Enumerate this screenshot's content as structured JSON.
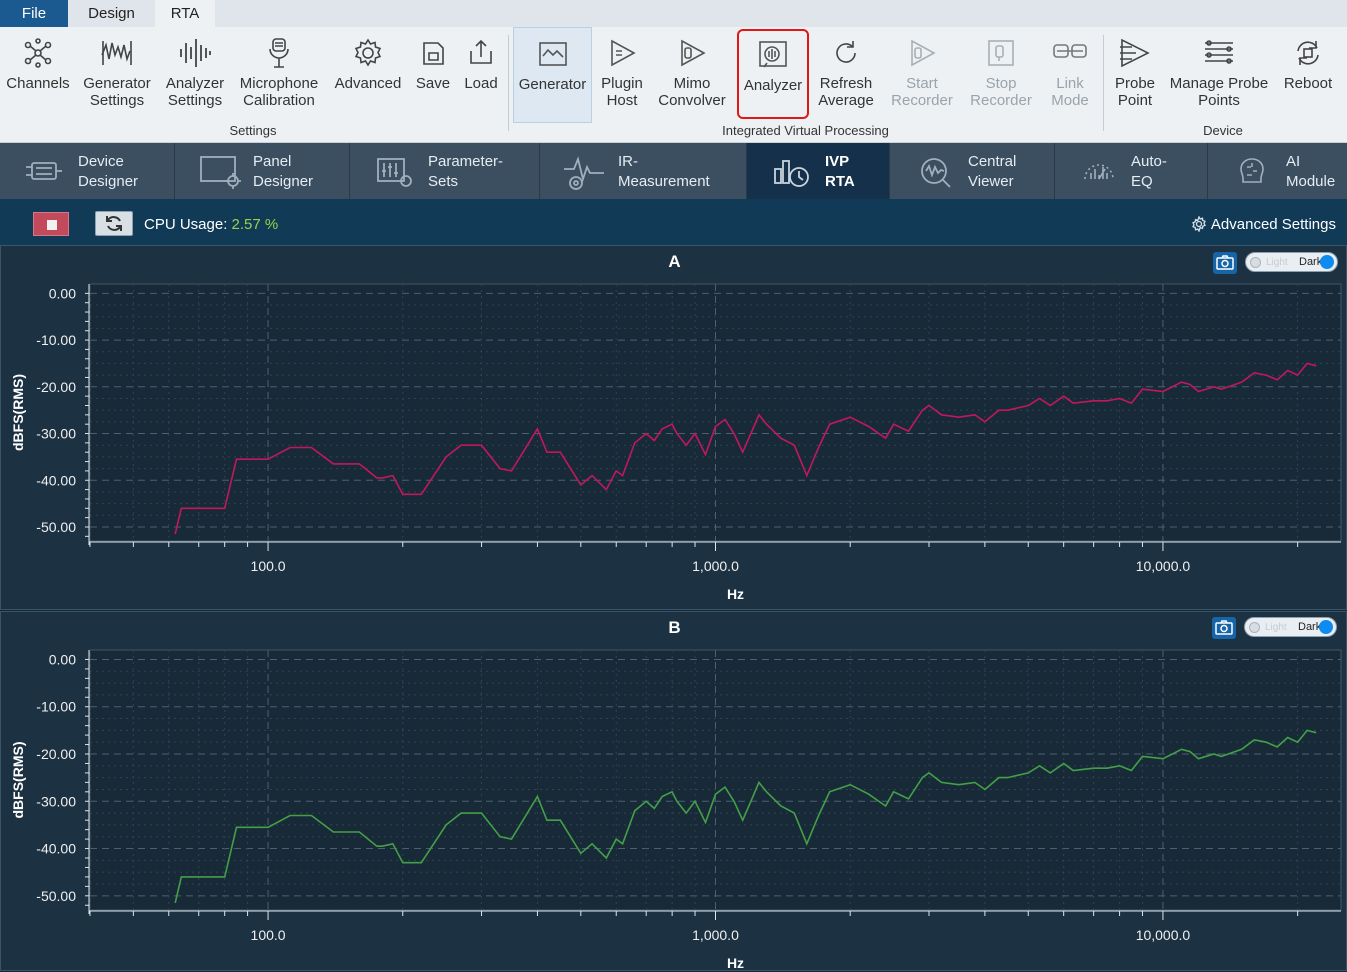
{
  "menu": {
    "tabs": [
      {
        "label": "File"
      },
      {
        "label": "Design"
      },
      {
        "label": "RTA"
      }
    ]
  },
  "ribbon": {
    "buttons": [
      {
        "label": "Channels",
        "icon": "channels-icon"
      },
      {
        "label": "Generator\nSettings",
        "icon": "generator-settings-icon"
      },
      {
        "label": "Analyzer\nSettings",
        "icon": "analyzer-settings-icon"
      },
      {
        "label": "Microphone\nCalibration",
        "icon": "microphone-icon"
      },
      {
        "label": "Advanced",
        "icon": "gear-icon"
      },
      {
        "label": "Save",
        "icon": "save-icon"
      },
      {
        "label": "Load",
        "icon": "load-icon"
      },
      {
        "label": "Generator",
        "icon": "generator-icon"
      },
      {
        "label": "Plugin\nHost",
        "icon": "plugin-host-icon"
      },
      {
        "label": "Mimo\nConvolver",
        "icon": "mimo-convolver-icon"
      },
      {
        "label": "Analyzer",
        "icon": "analyzer-icon"
      },
      {
        "label": "Refresh\nAverage",
        "icon": "refresh-icon"
      },
      {
        "label": "Start\nRecorder",
        "icon": "start-recorder-icon",
        "disabled": true
      },
      {
        "label": "Stop\nRecorder",
        "icon": "stop-recorder-icon",
        "disabled": true
      },
      {
        "label": "Link\nMode",
        "icon": "link-icon",
        "disabled": true
      },
      {
        "label": "Probe\nPoint",
        "icon": "probe-point-icon"
      },
      {
        "label": "Manage Probe\nPoints",
        "icon": "manage-probe-points-icon"
      },
      {
        "label": "Reboot",
        "icon": "reboot-icon"
      }
    ],
    "groups": [
      "Settings",
      "Integrated Virtual Processing",
      "Device"
    ]
  },
  "nav": {
    "tabs": [
      {
        "label": "Device\nDesigner",
        "icon": "device-designer-icon"
      },
      {
        "label": "Panel\nDesigner",
        "icon": "panel-designer-icon"
      },
      {
        "label": "Parameter-\nSets",
        "icon": "parameter-sets-icon"
      },
      {
        "label": "IR-\nMeasurement",
        "icon": "ir-measurement-icon"
      },
      {
        "label": "IVP\nRTA",
        "icon": "ivp-rta-icon",
        "active": true
      },
      {
        "label": "Central\nViewer",
        "icon": "central-viewer-icon"
      },
      {
        "label": "Auto-\nEQ",
        "icon": "auto-eq-icon"
      },
      {
        "label": "AI\nModule",
        "icon": "ai-module-icon"
      }
    ]
  },
  "status": {
    "cpu_label": "CPU Usage:",
    "cpu_value": "2.57",
    "cpu_unit": "%",
    "advanced_settings": "Advanced Settings"
  },
  "panels": [
    {
      "title": "A",
      "toggle_light": "Light",
      "toggle_dark": "Dark",
      "color": "#c2185b"
    },
    {
      "title": "B",
      "toggle_light": "Light",
      "toggle_dark": "Dark",
      "color": "#43a047"
    }
  ],
  "chart_data": [
    {
      "type": "line",
      "title": "A",
      "xlabel": "Hz",
      "ylabel": "dBFS(RMS)",
      "xscale": "log",
      "xlim": [
        40,
        25000
      ],
      "ylim": [
        -53,
        2
      ],
      "yticks": [
        "0.00",
        "-10.00",
        "-20.00",
        "-30.00",
        "-40.00",
        "-50.00"
      ],
      "xticks": [
        "100.0",
        "1,000.0",
        "10,000.0"
      ],
      "grid": true,
      "series": [
        {
          "color": "#c2185b",
          "x": [
            62,
            64,
            80,
            85,
            100,
            112,
            125,
            140,
            160,
            175,
            180,
            190,
            200,
            220,
            250,
            270,
            300,
            330,
            350,
            400,
            420,
            450,
            500,
            530,
            570,
            600,
            620,
            660,
            700,
            730,
            760,
            800,
            820,
            860,
            900,
            950,
            1000,
            1050,
            1100,
            1150,
            1200,
            1250,
            1300,
            1400,
            1500,
            1600,
            1700,
            1800,
            2000,
            2200,
            2400,
            2500,
            2700,
            2900,
            3000,
            3200,
            3500,
            3800,
            4000,
            4300,
            4500,
            5000,
            5300,
            5600,
            6000,
            6300,
            7000,
            7500,
            8000,
            8500,
            9000,
            10000,
            10500,
            11000,
            11500,
            12000,
            13000,
            13500,
            14500,
            15000,
            16000,
            17000,
            18000,
            19000,
            20000,
            21000,
            22000
          ],
          "y": [
            -51.5,
            -46,
            -46,
            -35.5,
            -35.5,
            -33,
            -33,
            -36.5,
            -36.5,
            -39.5,
            -39.5,
            -39,
            -43,
            -43,
            -35,
            -32.5,
            -32.5,
            -37.5,
            -38,
            -29,
            -34,
            -34,
            -41,
            -39,
            -42,
            -38,
            -39,
            -32,
            -30,
            -31.5,
            -29,
            -28,
            -30,
            -32.5,
            -30,
            -34.5,
            -28.5,
            -27,
            -30,
            -34,
            -30,
            -26,
            -28,
            -31,
            -32.5,
            -39,
            -33,
            -28,
            -26.5,
            -28.5,
            -31,
            -28,
            -29.5,
            -25,
            -24,
            -26,
            -26.5,
            -26,
            -27.5,
            -25,
            -25,
            -24,
            -22.5,
            -24,
            -22,
            -23.5,
            -23,
            -23,
            -22.5,
            -23.5,
            -20.5,
            -21,
            -20,
            -19,
            -19.5,
            -21,
            -20,
            -20.5,
            -19.5,
            -19,
            -17,
            -17.5,
            -18.5,
            -16.5,
            -17.5,
            -15,
            -15.5
          ]
        }
      ]
    },
    {
      "type": "line",
      "title": "B",
      "xlabel": "Hz",
      "ylabel": "dBFS(RMS)",
      "xscale": "log",
      "xlim": [
        40,
        25000
      ],
      "ylim": [
        -53,
        2
      ],
      "yticks": [
        "0.00",
        "-10.00",
        "-20.00",
        "-30.00",
        "-40.00",
        "-50.00"
      ],
      "xticks": [
        "100.0",
        "1,000.0",
        "10,000.0"
      ],
      "grid": true,
      "series": [
        {
          "color": "#43a047",
          "x": [
            62,
            64,
            80,
            85,
            100,
            112,
            125,
            140,
            160,
            175,
            180,
            190,
            200,
            220,
            250,
            270,
            300,
            330,
            350,
            400,
            420,
            450,
            500,
            530,
            570,
            600,
            620,
            660,
            700,
            730,
            760,
            800,
            820,
            860,
            900,
            950,
            1000,
            1050,
            1100,
            1150,
            1200,
            1250,
            1300,
            1400,
            1500,
            1600,
            1700,
            1800,
            2000,
            2200,
            2400,
            2500,
            2700,
            2900,
            3000,
            3200,
            3500,
            3800,
            4000,
            4300,
            4500,
            5000,
            5300,
            5600,
            6000,
            6300,
            7000,
            7500,
            8000,
            8500,
            9000,
            10000,
            10500,
            11000,
            11500,
            12000,
            13000,
            13500,
            14500,
            15000,
            16000,
            17000,
            18000,
            19000,
            20000,
            21000,
            22000
          ],
          "y": [
            -51.5,
            -46,
            -46,
            -35.5,
            -35.5,
            -33,
            -33,
            -36.5,
            -36.5,
            -39.5,
            -39.5,
            -39,
            -43,
            -43,
            -35,
            -32.5,
            -32.5,
            -37.5,
            -38,
            -29,
            -34,
            -34,
            -41,
            -39,
            -42,
            -38,
            -39,
            -32,
            -30,
            -31.5,
            -29,
            -28,
            -30,
            -32.5,
            -30,
            -34.5,
            -28.5,
            -27,
            -30,
            -34,
            -30,
            -26,
            -28,
            -31,
            -32.5,
            -39,
            -33,
            -28,
            -26.5,
            -28.5,
            -31,
            -28,
            -29.5,
            -25,
            -24,
            -26,
            -26.5,
            -26,
            -27.5,
            -25,
            -25,
            -24,
            -22.5,
            -24,
            -22,
            -23.5,
            -23,
            -23,
            -22.5,
            -23.5,
            -20.5,
            -21,
            -20,
            -19,
            -19.5,
            -21,
            -20,
            -20.5,
            -19.5,
            -19,
            -17,
            -17.5,
            -18.5,
            -16.5,
            -17.5,
            -15,
            -15.5
          ]
        }
      ]
    }
  ]
}
